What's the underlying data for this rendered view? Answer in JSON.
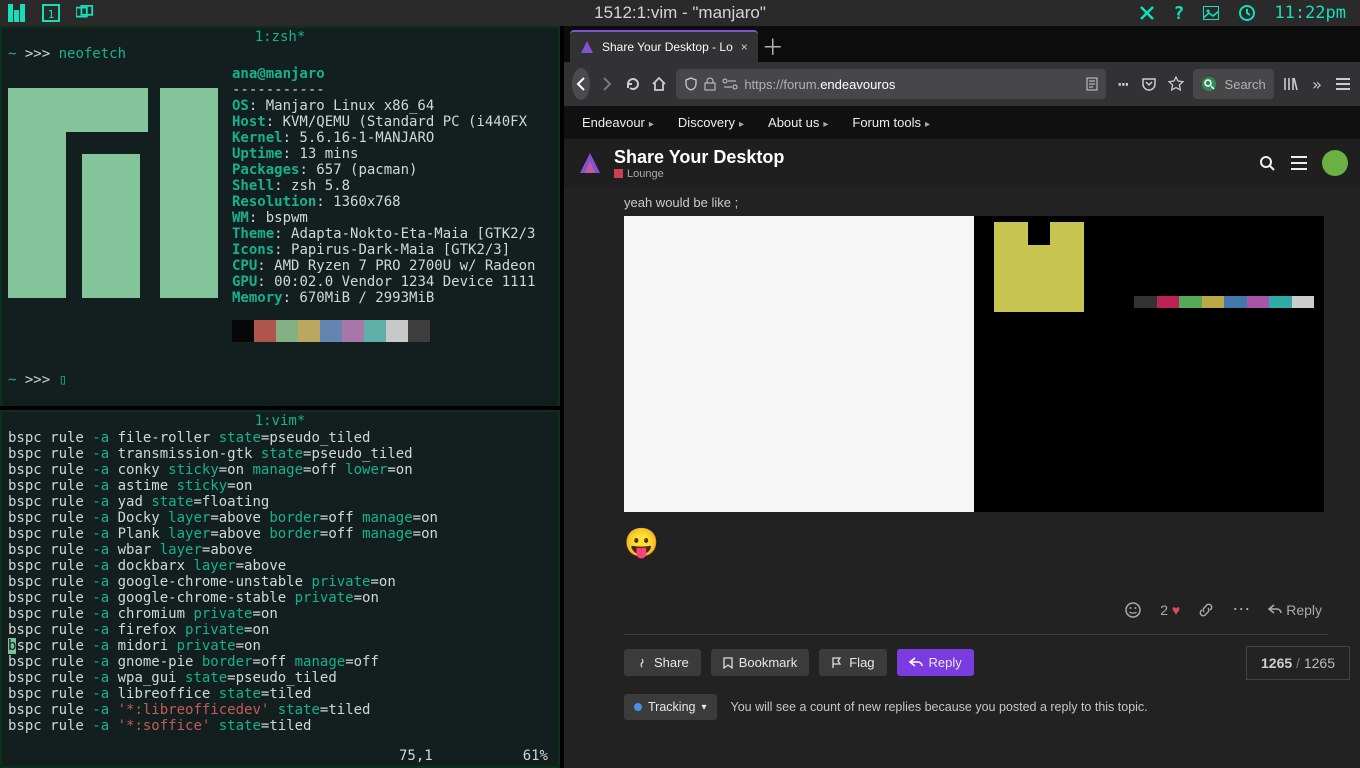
{
  "topbar": {
    "title": "1512:1:vim - \"manjaro\"",
    "clock": "11:22pm"
  },
  "zsh": {
    "tab": "1:zsh*",
    "prompt_indicator": "~",
    "prompt_arrows": ">>> ",
    "cmd": "neofetch",
    "userhost": "ana@manjaro",
    "rule": "-----------",
    "info": [
      {
        "k": "OS",
        "v": ": Manjaro Linux x86_64"
      },
      {
        "k": "Host",
        "v": ": KVM/QEMU (Standard PC (i440FX"
      },
      {
        "k": "Kernel",
        "v": ": 5.6.16-1-MANJARO"
      },
      {
        "k": "Uptime",
        "v": ": 13 mins"
      },
      {
        "k": "Packages",
        "v": ": 657 (pacman)"
      },
      {
        "k": "Shell",
        "v": ": zsh 5.8"
      },
      {
        "k": "Resolution",
        "v": ": 1360x768"
      },
      {
        "k": "WM",
        "v": ": bspwm"
      },
      {
        "k": "Theme",
        "v": ": Adapta-Nokto-Eta-Maia [GTK2/3"
      },
      {
        "k": "Icons",
        "v": ": Papirus-Dark-Maia [GTK2/3]"
      },
      {
        "k": "CPU",
        "v": ": AMD Ryzen 7 PRO 2700U w/ Radeon"
      },
      {
        "k": "GPU",
        "v": ": 00:02.0 Vendor 1234 Device 1111"
      },
      {
        "k": "Memory",
        "v": ": 670MiB / 2993MiB"
      }
    ],
    "swatches": [
      "#070707",
      "#b0554e",
      "#84b084",
      "#bba760",
      "#6684b0",
      "#a876a8",
      "#5fb0a8",
      "#c8c8c8",
      "#3d3d3d"
    ],
    "prompt2_indicator": "~",
    "prompt2_arrows": ">>> ",
    "prompt2_cursor": "▯"
  },
  "vim": {
    "tab": "1:vim*",
    "lines": [
      [
        [
          "cmt",
          "bspc rule "
        ],
        [
          "op",
          "-a"
        ],
        [
          "cmt",
          " file-roller "
        ],
        [
          "kw",
          "state"
        ],
        [
          "cmt",
          "=pseudo_tiled"
        ]
      ],
      [
        [
          "cmt",
          "bspc rule "
        ],
        [
          "op",
          "-a"
        ],
        [
          "cmt",
          " transmission-gtk "
        ],
        [
          "kw",
          "state"
        ],
        [
          "cmt",
          "=pseudo_tiled"
        ]
      ],
      [
        [
          "cmt",
          "bspc rule "
        ],
        [
          "op",
          "-a"
        ],
        [
          "cmt",
          " conky "
        ],
        [
          "kw",
          "sticky"
        ],
        [
          "cmt",
          "=on "
        ],
        [
          "kw",
          "manage"
        ],
        [
          "cmt",
          "=off "
        ],
        [
          "kw",
          "lower"
        ],
        [
          "cmt",
          "=on"
        ]
      ],
      [
        [
          "cmt",
          "bspc rule "
        ],
        [
          "op",
          "-a"
        ],
        [
          "cmt",
          " astime "
        ],
        [
          "kw",
          "sticky"
        ],
        [
          "cmt",
          "=on"
        ]
      ],
      [
        [
          "cmt",
          "bspc rule "
        ],
        [
          "op",
          "-a"
        ],
        [
          "cmt",
          " yad "
        ],
        [
          "kw",
          "state"
        ],
        [
          "cmt",
          "=floating"
        ]
      ],
      [
        [
          "cmt",
          "bspc rule "
        ],
        [
          "op",
          "-a"
        ],
        [
          "cmt",
          " Docky "
        ],
        [
          "kw",
          "layer"
        ],
        [
          "cmt",
          "=above "
        ],
        [
          "kw",
          "border"
        ],
        [
          "cmt",
          "=off "
        ],
        [
          "kw",
          "manage"
        ],
        [
          "cmt",
          "=on"
        ]
      ],
      [
        [
          "cmt",
          "bspc rule "
        ],
        [
          "op",
          "-a"
        ],
        [
          "cmt",
          " Plank "
        ],
        [
          "kw",
          "layer"
        ],
        [
          "cmt",
          "=above "
        ],
        [
          "kw",
          "border"
        ],
        [
          "cmt",
          "=off "
        ],
        [
          "kw",
          "manage"
        ],
        [
          "cmt",
          "=on"
        ]
      ],
      [
        [
          "cmt",
          "bspc rule "
        ],
        [
          "op",
          "-a"
        ],
        [
          "cmt",
          " wbar "
        ],
        [
          "kw",
          "layer"
        ],
        [
          "cmt",
          "=above"
        ]
      ],
      [
        [
          "cmt",
          "bspc rule "
        ],
        [
          "op",
          "-a"
        ],
        [
          "cmt",
          " dockbarx "
        ],
        [
          "kw",
          "layer"
        ],
        [
          "cmt",
          "=above"
        ]
      ],
      [
        [
          "cmt",
          "bspc rule "
        ],
        [
          "op",
          "-a"
        ],
        [
          "cmt",
          " google-chrome-unstable "
        ],
        [
          "kw",
          "private"
        ],
        [
          "cmt",
          "=on"
        ]
      ],
      [
        [
          "cmt",
          "bspc rule "
        ],
        [
          "op",
          "-a"
        ],
        [
          "cmt",
          " google-chrome-stable "
        ],
        [
          "kw",
          "private"
        ],
        [
          "cmt",
          "=on"
        ]
      ],
      [
        [
          "cmt",
          "bspc rule "
        ],
        [
          "op",
          "-a"
        ],
        [
          "cmt",
          " chromium "
        ],
        [
          "kw",
          "private"
        ],
        [
          "cmt",
          "=on"
        ]
      ],
      [
        [
          "cmt",
          "bspc rule "
        ],
        [
          "op",
          "-a"
        ],
        [
          "cmt",
          " firefox "
        ],
        [
          "kw",
          "private"
        ],
        [
          "cmt",
          "=on"
        ]
      ],
      [
        [
          "cur",
          "b"
        ],
        [
          "cmt",
          "spc rule "
        ],
        [
          "op",
          "-a"
        ],
        [
          "cmt",
          " midori "
        ],
        [
          "kw",
          "private"
        ],
        [
          "cmt",
          "=on"
        ]
      ],
      [
        [
          "cmt",
          "bspc rule "
        ],
        [
          "op",
          "-a"
        ],
        [
          "cmt",
          " gnome-pie "
        ],
        [
          "kw",
          "border"
        ],
        [
          "cmt",
          "=off "
        ],
        [
          "kw",
          "manage"
        ],
        [
          "cmt",
          "=off"
        ]
      ],
      [
        [
          "cmt",
          "bspc rule "
        ],
        [
          "op",
          "-a"
        ],
        [
          "cmt",
          " wpa_gui "
        ],
        [
          "kw",
          "state"
        ],
        [
          "cmt",
          "=pseudo_tiled"
        ]
      ],
      [
        [
          "cmt",
          "bspc rule "
        ],
        [
          "op",
          "-a"
        ],
        [
          "cmt",
          " libreoffice "
        ],
        [
          "kw",
          "state"
        ],
        [
          "cmt",
          "=tiled"
        ]
      ],
      [
        [
          "cmt",
          "bspc rule "
        ],
        [
          "op",
          "-a"
        ],
        [
          "cmt",
          " "
        ],
        [
          "str",
          "'*:libreofficedev'"
        ],
        [
          "cmt",
          " "
        ],
        [
          "kw",
          "state"
        ],
        [
          "cmt",
          "=tiled"
        ]
      ],
      [
        [
          "cmt",
          "bspc rule "
        ],
        [
          "op",
          "-a"
        ],
        [
          "cmt",
          " "
        ],
        [
          "str",
          "'*:soffice'"
        ],
        [
          "cmt",
          " "
        ],
        [
          "kw",
          "state"
        ],
        [
          "cmt",
          "=tiled"
        ]
      ]
    ],
    "status_pos": "75,1",
    "status_pct": "61%"
  },
  "firefox": {
    "tab_title": "Share Your Desktop - Lo",
    "url_pre": "https://forum.",
    "url_host": "endeavouros",
    "search_placeholder": "Search",
    "eostop": [
      "Endeavour",
      "Discovery",
      "About us",
      "Forum tools"
    ],
    "forum_title": "Share Your Desktop",
    "forum_cat": "Lounge",
    "post_line": "yeah would be like ;",
    "emoji": "😛",
    "like_count": "2",
    "reply_label": "Reply",
    "progress_current": "1265",
    "progress_sep": " / ",
    "progress_total": "1265",
    "btn_share": "Share",
    "btn_bookmark": "Bookmark",
    "btn_flag": "Flag",
    "btn_reply": "Reply",
    "track_label": "Tracking",
    "track_msg": "You will see a count of new replies because you posted a reply to this topic."
  }
}
